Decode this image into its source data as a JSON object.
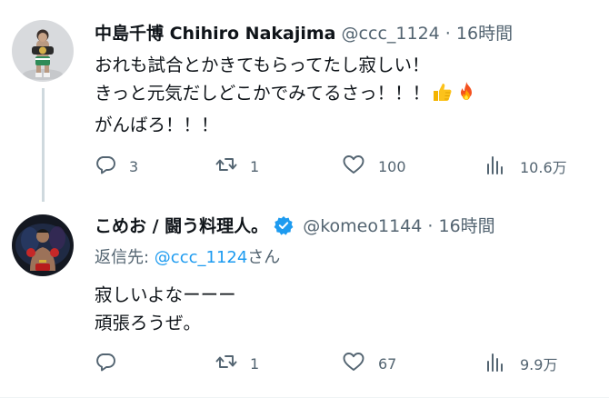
{
  "tweets": [
    {
      "author": {
        "display_name": "中島千博 Chihiro Nakajima",
        "handle": "@ccc_1124",
        "verified": false
      },
      "separator": "·",
      "time": "16時間",
      "text_lines": [
        "おれも試合とかきてもらってたし寂しい！",
        "きっと元気だしどこかでみてるさっ！！！",
        "がんばろ！！！"
      ],
      "emojis": [
        "thumbs-up-emoji",
        "fire-emoji"
      ],
      "stats": {
        "replies": "3",
        "retweets": "1",
        "likes": "100",
        "views": "10.6万"
      }
    },
    {
      "author": {
        "display_name": "こめお / 闘う料理人。",
        "handle": "@komeo1144",
        "verified": true
      },
      "separator": "·",
      "time": "16時間",
      "reply_to": {
        "prefix": "返信先: ",
        "mention": "@ccc_1124",
        "suffix": "さん"
      },
      "text_lines": [
        "寂しいよなーーー",
        "頑張ろうぜ。"
      ],
      "stats": {
        "replies": "",
        "retweets": "1",
        "likes": "67",
        "views": "9.9万"
      }
    }
  ],
  "colors": {
    "text_primary": "#0f1419",
    "text_secondary": "#536471",
    "link": "#1d9bf0",
    "verified_badge": "#1d9bf0",
    "thread_line": "#cfd9de"
  },
  "icons": {
    "reply": "speech-bubble-icon",
    "retweet": "retweet-arrows-icon",
    "like": "heart-icon",
    "views": "bar-chart-icon",
    "verified": "verified-badge-icon"
  }
}
